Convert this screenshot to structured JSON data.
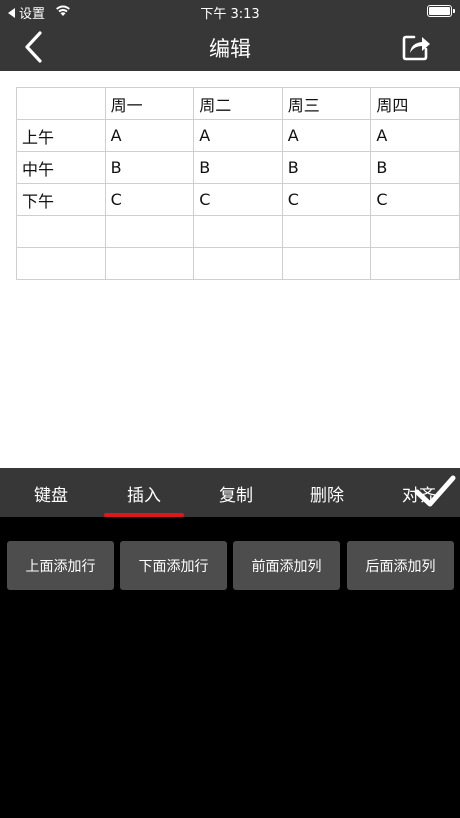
{
  "status_bar": {
    "back_app": "设置",
    "time": "下午 3:13",
    "icons": [
      "back-triangle-icon",
      "wifi-icon",
      "battery-icon"
    ]
  },
  "nav": {
    "title": "编辑",
    "icons": [
      "chevron-left-icon",
      "share-icon"
    ]
  },
  "table": {
    "rows": [
      [
        "",
        "周一",
        "周二",
        "周三",
        "周四"
      ],
      [
        "上午",
        "A",
        "A",
        "A",
        "A"
      ],
      [
        "中午",
        "B",
        "B",
        "B",
        "B"
      ],
      [
        "下午",
        "C",
        "C",
        "C",
        "C"
      ],
      [
        "",
        "",
        "",
        "",
        ""
      ],
      [
        "",
        "",
        "",
        "",
        ""
      ]
    ]
  },
  "toolbar": {
    "tabs": [
      {
        "label": "键盘"
      },
      {
        "label": "插入"
      },
      {
        "label": "复制"
      },
      {
        "label": "删除"
      },
      {
        "label": "对齐"
      }
    ],
    "active_tab": "插入",
    "accent_color": "#e0161b",
    "confirm_icon": "checkmark-icon"
  },
  "insert_panel": {
    "buttons": [
      "上面添加行",
      "下面添加行",
      "前面添加列",
      "后面添加列"
    ]
  }
}
